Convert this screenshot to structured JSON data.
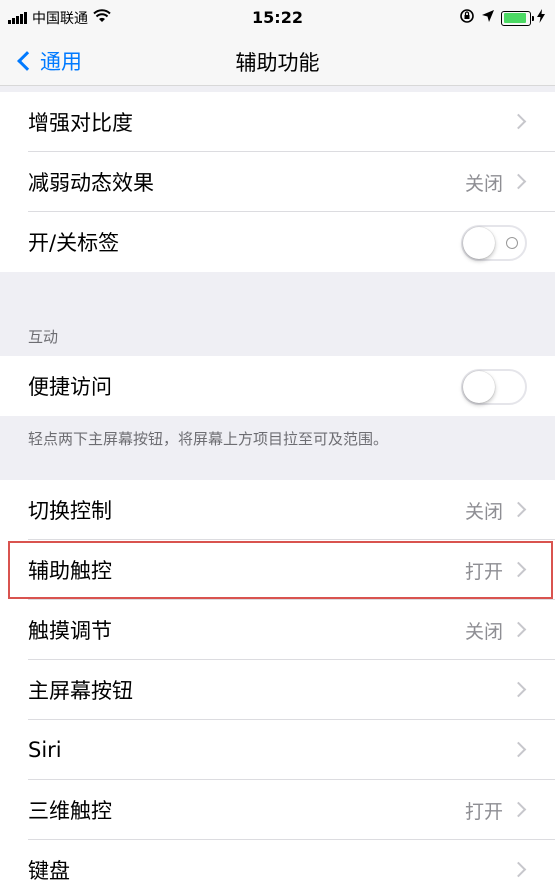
{
  "status_bar": {
    "carrier": "中国联通",
    "time": "15:22",
    "icons": [
      "signal-icon",
      "wifi-icon",
      "orientation-lock-icon",
      "location-icon",
      "battery-icon",
      "charging-icon"
    ],
    "battery_color": "#4cd964"
  },
  "nav": {
    "back_label": "通用",
    "title": "辅助功能"
  },
  "group1": {
    "rows": [
      {
        "label": "增强对比度",
        "value": ""
      },
      {
        "label": "减弱动态效果",
        "value": "关闭"
      },
      {
        "label": "开/关标签",
        "toggle": false
      }
    ]
  },
  "interaction": {
    "header": "互动",
    "rows": [
      {
        "label": "便捷访问",
        "toggle": false
      }
    ],
    "footer": "轻点两下主屏幕按钮，将屏幕上方项目拉至可及范围。"
  },
  "group3": {
    "rows": [
      {
        "label": "切换控制",
        "value": "关闭"
      },
      {
        "label": "辅助触控",
        "value": "打开"
      },
      {
        "label": "触摸调节",
        "value": "关闭"
      },
      {
        "label": "主屏幕按钮",
        "value": ""
      },
      {
        "label": "Siri",
        "value": ""
      },
      {
        "label": "三维触控",
        "value": "打开"
      },
      {
        "label": "键盘",
        "value": ""
      }
    ]
  },
  "colors": {
    "accent": "#007aff",
    "highlight_border": "#d9534f"
  }
}
